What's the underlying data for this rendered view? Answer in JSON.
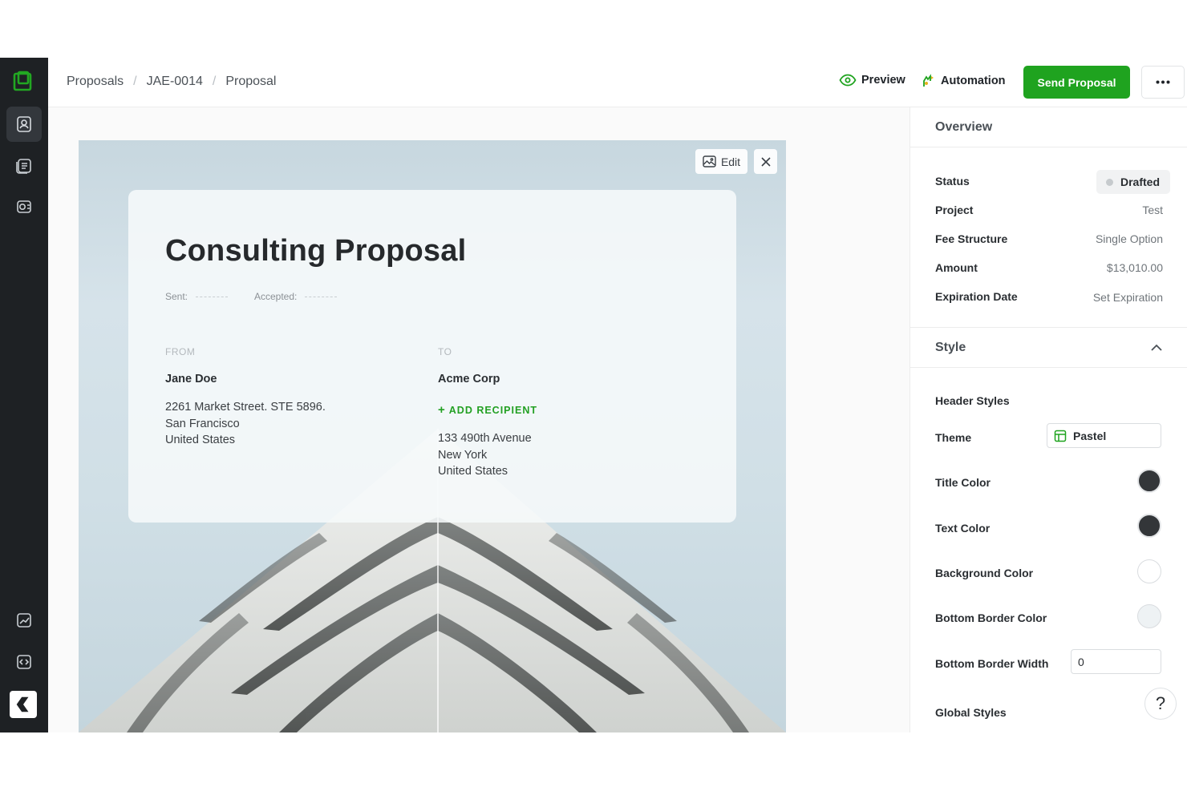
{
  "breadcrumb": {
    "items": [
      "Proposals",
      "JAE-0014",
      "Proposal"
    ],
    "separator": "/"
  },
  "topbar": {
    "preview_label": "Preview",
    "automation_label": "Automation",
    "send_label": "Send Proposal",
    "more_icon": "ellipsis-icon",
    "accent_color": "#1fa31f"
  },
  "sidebar": {
    "items": [
      {
        "icon": "contacts-icon",
        "active": true
      },
      {
        "icon": "documents-icon",
        "active": false
      },
      {
        "icon": "payments-icon",
        "active": false
      },
      {
        "icon": "analytics-icon",
        "active": false
      },
      {
        "icon": "code-icon",
        "active": false
      }
    ]
  },
  "canvas": {
    "edit_label": "Edit",
    "close_icon": "close-icon",
    "image_icon": "image-icon"
  },
  "proposal": {
    "title": "Consulting Proposal",
    "sent_label": "Sent:",
    "accepted_label": "Accepted:",
    "from": {
      "label": "FROM",
      "name": "Jane Doe",
      "address": [
        "2261 Market Street. STE 5896.",
        "San Francisco",
        "United States"
      ]
    },
    "to": {
      "label": "TO",
      "name": "Acme Corp",
      "add_recipient": "ADD RECIPIENT",
      "address": [
        "133 490th Avenue",
        "New York",
        "United States"
      ]
    }
  },
  "overview": {
    "title": "Overview",
    "status_label": "Status",
    "status_value": "Drafted",
    "project_label": "Project",
    "project_value": "Test",
    "fee_label": "Fee Structure",
    "fee_value": "Single Option",
    "amount_label": "Amount",
    "amount_value": "$13,010.00",
    "expiration_label": "Expiration Date",
    "expiration_value": "Set Expiration"
  },
  "style": {
    "title": "Style",
    "header_styles": "Header Styles",
    "theme_label": "Theme",
    "theme_value": "Pastel",
    "title_color_label": "Title Color",
    "title_color": "#333639",
    "text_color_label": "Text Color",
    "text_color": "#333639",
    "background_color_label": "Background Color",
    "background_color": "#ffffff",
    "bottom_border_color_label": "Bottom Border Color",
    "bottom_border_color": "#eef2f4",
    "bottom_border_width_label": "Bottom Border Width",
    "bottom_border_width": "0",
    "global_styles": "Global Styles",
    "help_label": "?"
  }
}
